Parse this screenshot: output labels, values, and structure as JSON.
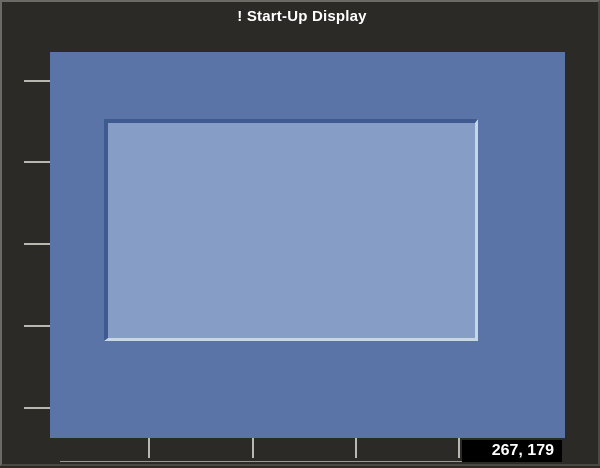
{
  "window": {
    "title": "! Start-Up Display"
  },
  "status": {
    "coordinates": "267, 179"
  },
  "colors": {
    "background": "#2b2a26",
    "canvas": "#5a74a8",
    "panel": "#869dc6",
    "panel_highlight": "#c9d6ea",
    "panel_shadow": "#3f5a8f"
  }
}
